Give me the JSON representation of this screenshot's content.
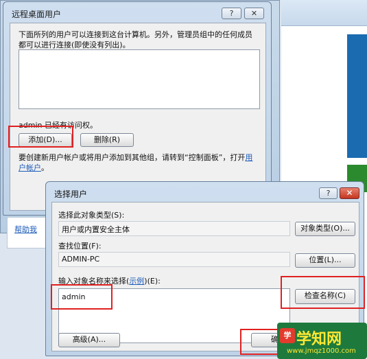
{
  "remote_desktop_dialog": {
    "title": "远程桌面用户",
    "help_btn": "?",
    "close_btn": "✕",
    "description": "下面所列的用户可以连接到这台计算机。另外，管理员组中的任何成员都可以进行连接(即使没有列出)。",
    "access_note": "admin 已经有访问权。",
    "add_btn": "添加(D)...",
    "remove_btn": "删除(R)",
    "note_prefix": "要创建新用户帐户或将用户添加到其他组，请转到“控制面板”，打开",
    "note_link": "用户帐户",
    "note_suffix": "。"
  },
  "background": {
    "help_link": "帮助我"
  },
  "select_user_dialog": {
    "title": "选择用户",
    "help_btn": "?",
    "close_btn": "✕",
    "object_type_label": "选择此对象类型(S):",
    "object_type_value": "用户或内置安全主体",
    "object_type_btn": "对象类型(O)...",
    "location_label": "查找位置(F):",
    "location_value": "ADMIN-PC",
    "location_btn": "位置(L)...",
    "enter_names_label_prefix": "输入对象名称来选择(",
    "enter_names_label_link": "示例",
    "enter_names_label_suffix": ")(E):",
    "enter_names_value": "admin",
    "check_names_btn": "检查名称(C)",
    "advanced_btn": "高级(A)...",
    "ok_btn": "确定"
  },
  "watermark": {
    "seal": "学",
    "main": "学知网",
    "sub": "www.jmqz1000.com"
  },
  "colors": {
    "highlight": "#e02020",
    "link": "#1c5bb8"
  }
}
